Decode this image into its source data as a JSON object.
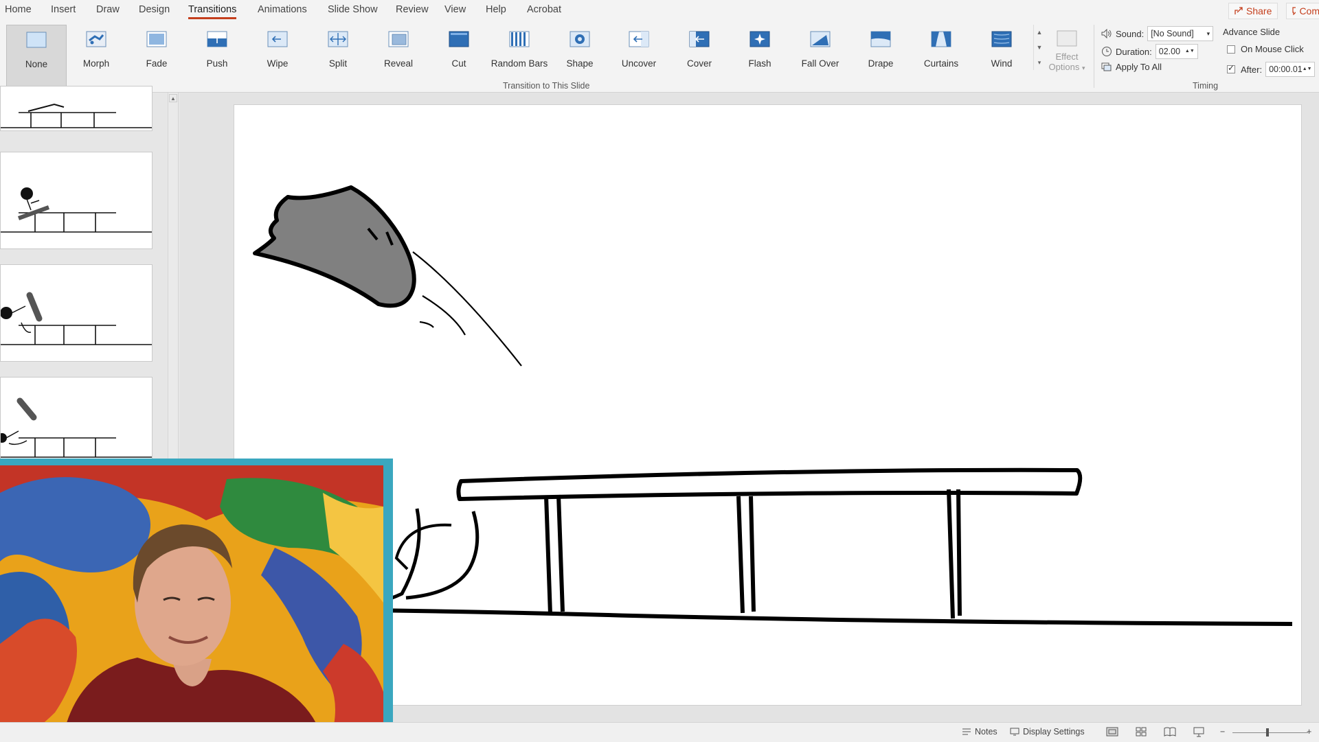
{
  "tabs": [
    "Home",
    "Insert",
    "Draw",
    "Design",
    "Transitions",
    "Animations",
    "Slide Show",
    "Review",
    "View",
    "Help",
    "Acrobat"
  ],
  "active_tab": "Transitions",
  "share_label": "Share",
  "comments_label": "Com",
  "transitions": [
    {
      "label": "None",
      "icon": "none-icon"
    },
    {
      "label": "Morph",
      "icon": "morph-icon"
    },
    {
      "label": "Fade",
      "icon": "fade-icon"
    },
    {
      "label": "Push",
      "icon": "push-icon"
    },
    {
      "label": "Wipe",
      "icon": "wipe-icon"
    },
    {
      "label": "Split",
      "icon": "split-icon"
    },
    {
      "label": "Reveal",
      "icon": "reveal-icon"
    },
    {
      "label": "Cut",
      "icon": "cut-icon"
    },
    {
      "label": "Random Bars",
      "icon": "random-bars-icon"
    },
    {
      "label": "Shape",
      "icon": "shape-icon"
    },
    {
      "label": "Uncover",
      "icon": "uncover-icon"
    },
    {
      "label": "Cover",
      "icon": "cover-icon"
    },
    {
      "label": "Flash",
      "icon": "flash-icon"
    },
    {
      "label": "Fall Over",
      "icon": "fall-over-icon"
    },
    {
      "label": "Drape",
      "icon": "drape-icon"
    },
    {
      "label": "Curtains",
      "icon": "curtains-icon"
    },
    {
      "label": "Wind",
      "icon": "wind-icon"
    }
  ],
  "selected_transition": "None",
  "effect_options": {
    "line1": "Effect",
    "line2": "Options"
  },
  "transition_group_label": "Transition to This Slide",
  "timing": {
    "sound_label": "Sound:",
    "sound_value": "[No Sound]",
    "duration_label": "Duration:",
    "duration_value": "02.00",
    "apply_all_label": "Apply To All",
    "advance_slide_label": "Advance Slide",
    "on_mouse_click_label": "On Mouse Click",
    "on_mouse_click_checked": false,
    "after_label": "After:",
    "after_checked": true,
    "after_value": "00:00.01",
    "group_label": "Timing"
  },
  "statusbar": {
    "notes_label": "Notes",
    "display_settings_label": "Display Settings"
  },
  "colors": {
    "accent": "#c43e1c",
    "ribbon_bg": "#f3f3f3",
    "webcam_border": "#3aa7bf"
  }
}
